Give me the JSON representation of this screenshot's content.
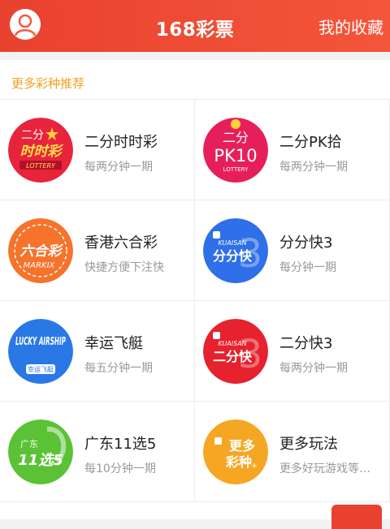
{
  "header": {
    "title": "168彩票",
    "favorites_label": "我的收藏"
  },
  "section": {
    "title": "更多彩种推荐"
  },
  "games": [
    {
      "name": "二分时时彩",
      "desc": "每两分钟一期",
      "logo_text": "时时彩",
      "logo_top": "二分",
      "logo_sub": "LOTTERY",
      "logo_color": "#e8243c"
    },
    {
      "name": "二分PK拾",
      "desc": "每两分钟一期",
      "logo_text": "PK10",
      "logo_top": "二分",
      "logo_sub": "LOTTERY",
      "logo_color": "#e61f5a"
    },
    {
      "name": "香港六合彩",
      "desc": "快捷方便下注快",
      "logo_text": "六合彩",
      "logo_top": "",
      "logo_sub": "MARKIX",
      "logo_color": "#f5732b"
    },
    {
      "name": "分分快3",
      "desc": "每分钟一期",
      "logo_text": "分分快",
      "logo_top": "KUAISAN",
      "logo_sub": "3",
      "logo_color": "#2f6fe8"
    },
    {
      "name": "幸运飞艇",
      "desc": "每五分钟一期",
      "logo_text": "LUCKY AIRSHIP",
      "logo_top": "",
      "logo_sub": "幸运飞艇",
      "logo_color": "#2a78e6"
    },
    {
      "name": "二分快3",
      "desc": "每两分钟一期",
      "logo_text": "二分快",
      "logo_top": "KUAISAN",
      "logo_sub": "3",
      "logo_color": "#e5222d"
    },
    {
      "name": "广东11选5",
      "desc": "每10分钟一期",
      "logo_text": "11选5",
      "logo_top": "广东",
      "logo_sub": "",
      "logo_color": "#5bc236"
    },
    {
      "name": "更多玩法",
      "desc": "更多好玩游戏等…",
      "logo_text": "更多",
      "logo_top": "",
      "logo_sub": "彩种",
      "logo_color": "#f5a623"
    }
  ]
}
